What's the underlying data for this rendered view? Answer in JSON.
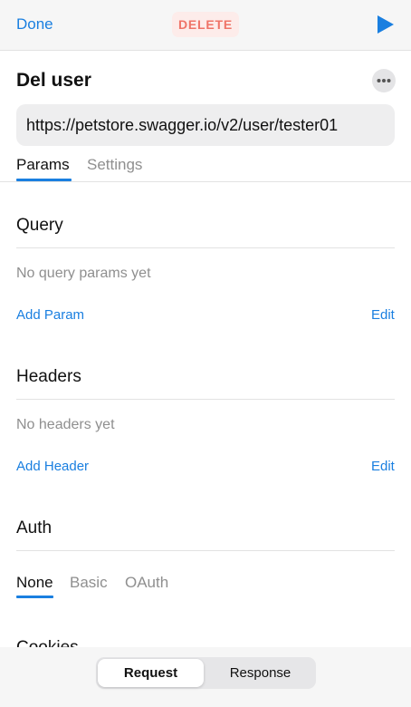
{
  "toolbar": {
    "done_label": "Done",
    "method": "DELETE",
    "run_icon": "play-icon"
  },
  "request": {
    "name": "Del user",
    "more_icon": "ellipsis-icon",
    "url": "https://petstore.swagger.io/v2/user/tester01"
  },
  "tabs": [
    {
      "label": "Params",
      "active": true
    },
    {
      "label": "Settings",
      "active": false
    }
  ],
  "query": {
    "title": "Query",
    "empty_text": "No query params yet",
    "add_label": "Add Param",
    "edit_label": "Edit"
  },
  "headers": {
    "title": "Headers",
    "empty_text": "No headers yet",
    "add_label": "Add Header",
    "edit_label": "Edit"
  },
  "auth": {
    "title": "Auth",
    "options": [
      {
        "label": "None",
        "active": true
      },
      {
        "label": "Basic",
        "active": false
      },
      {
        "label": "OAuth",
        "active": false
      }
    ]
  },
  "cookies": {
    "title": "Cookies"
  },
  "bottom": {
    "request_label": "Request",
    "response_label": "Response",
    "active": "Request"
  },
  "colors": {
    "accent": "#1a7fe0",
    "method_text": "#ef7468",
    "method_bg": "#fdecea",
    "muted_text": "#8f8f8f"
  }
}
